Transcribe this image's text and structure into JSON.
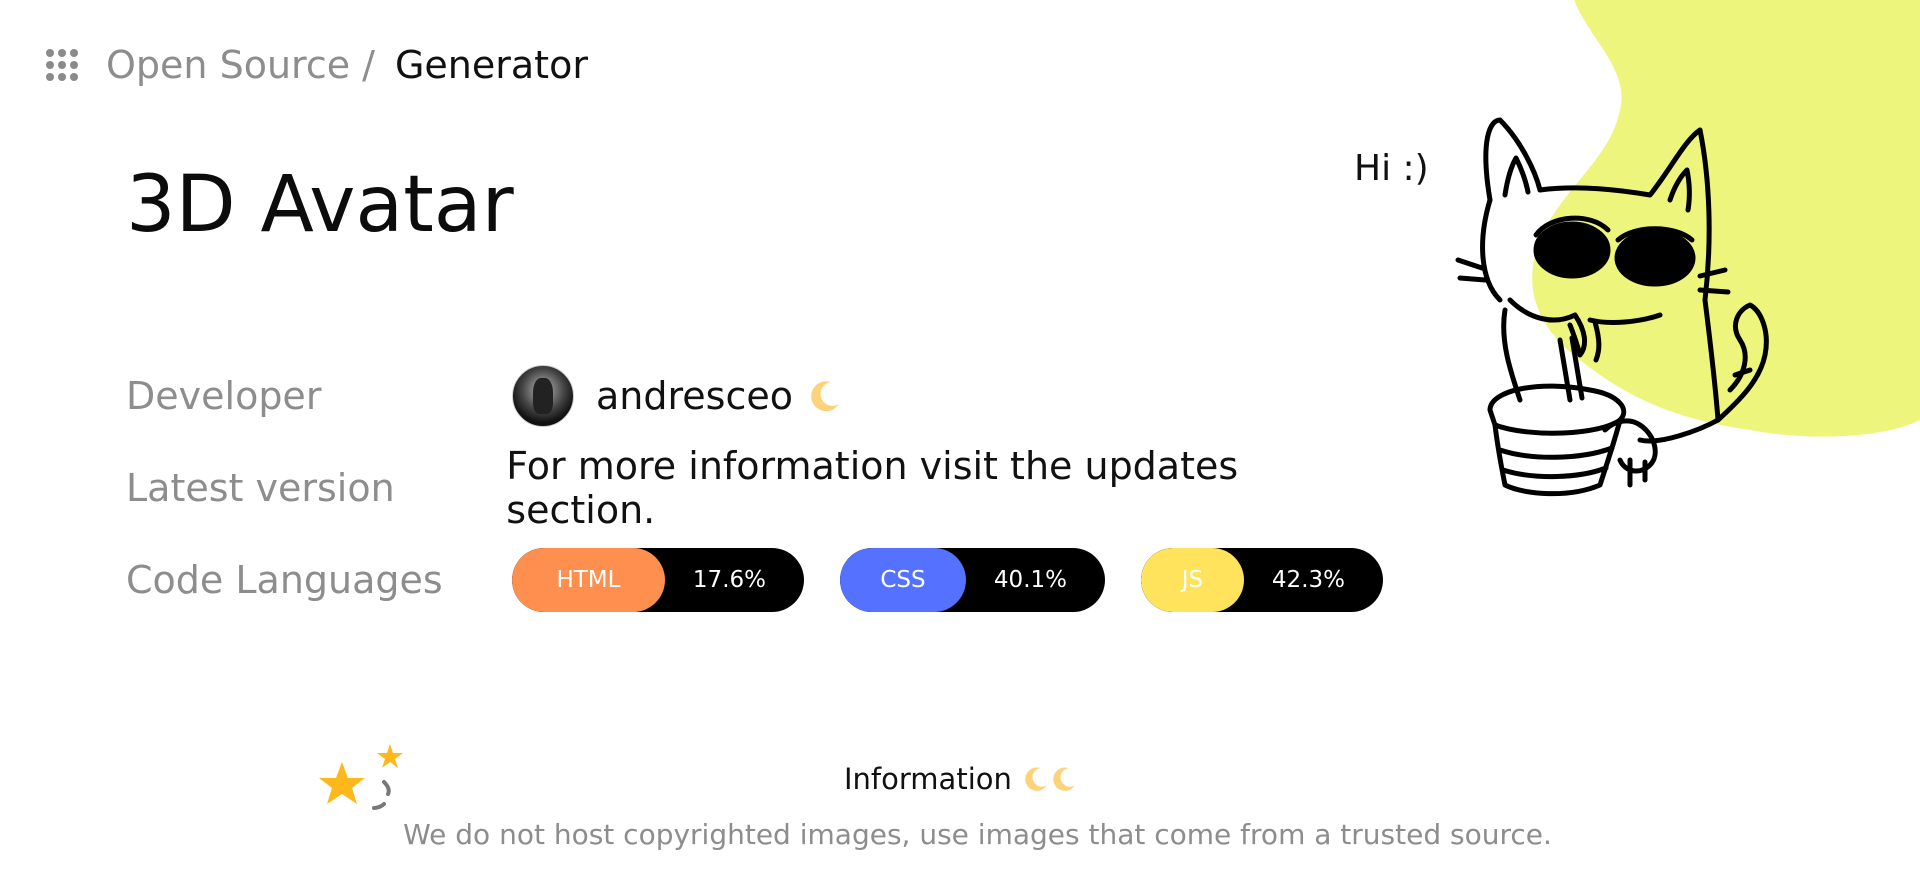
{
  "breadcrumb": {
    "parent": "Open Source /",
    "current": "Generator"
  },
  "page": {
    "title": "3D Avatar"
  },
  "info": {
    "developer_label": "Developer",
    "developer_name": "andresceo",
    "version_label": "Latest version",
    "version_text": "For more information visit the updates section.",
    "languages_label": "Code Languages",
    "languages": [
      {
        "name": "HTML",
        "percent": "17.6%",
        "color": "#ff8f4e"
      },
      {
        "name": "CSS",
        "percent": "40.1%",
        "color": "#5472ff"
      },
      {
        "name": "JS",
        "percent": "42.3%",
        "color": "#ffe35c"
      }
    ]
  },
  "illustration": {
    "speech": "Hi :)"
  },
  "footer": {
    "title": "Information",
    "description": "We do not host copyrighted images, use images that come from a trusted source."
  },
  "colors": {
    "blob": "#eef57d",
    "accent_moon": "#fcd37a",
    "star": "#ffb81c"
  }
}
